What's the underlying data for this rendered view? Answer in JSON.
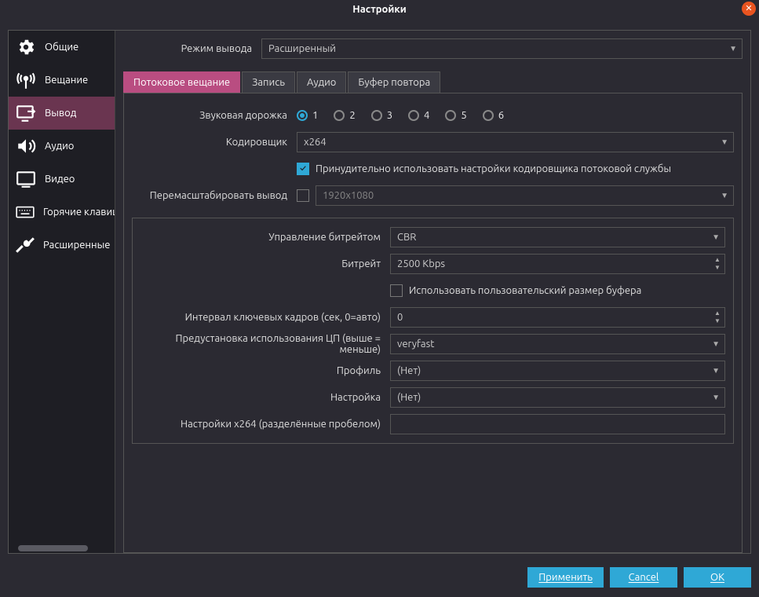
{
  "colors": {
    "accent": "#2fa8d6",
    "tab_active": "#b94d81",
    "sidebar_selected": "#6a3550"
  },
  "title": "Настройки",
  "sidebar": {
    "items": [
      {
        "id": "general",
        "label": "Общие"
      },
      {
        "id": "stream",
        "label": "Вещание"
      },
      {
        "id": "output",
        "label": "Вывод"
      },
      {
        "id": "audio",
        "label": "Аудио"
      },
      {
        "id": "video",
        "label": "Видео"
      },
      {
        "id": "hotkeys",
        "label": "Горячие клавиши"
      },
      {
        "id": "advanced",
        "label": "Расширенные"
      }
    ],
    "selected": "output"
  },
  "output_mode": {
    "label": "Режим вывода",
    "value": "Расширенный"
  },
  "tabs": [
    {
      "id": "streaming",
      "label": "Потоковое вещание"
    },
    {
      "id": "recording",
      "label": "Запись"
    },
    {
      "id": "audio",
      "label": "Аудио"
    },
    {
      "id": "replay",
      "label": "Буфер повтора"
    }
  ],
  "active_tab": "streaming",
  "streaming": {
    "audio_track_label": "Звуковая дорожка",
    "audio_tracks": [
      "1",
      "2",
      "3",
      "4",
      "5",
      "6"
    ],
    "audio_track_selected": "1",
    "encoder_label": "Кодировщик",
    "encoder_value": "x264",
    "enforce_label": "Принудительно использовать настройки кодировщика потоковой службы",
    "enforce_checked": true,
    "rescale_label": "Перемасштабировать вывод",
    "rescale_checked": false,
    "rescale_value": "1920x1080",
    "rate_control_label": "Управление битрейтом",
    "rate_control_value": "CBR",
    "bitrate_label": "Битрейт",
    "bitrate_value": "2500 Kbps",
    "custom_buf_label": "Использовать пользовательский размер буфера",
    "custom_buf_checked": false,
    "keyint_label": "Интервал ключевых кадров (сек, 0=авто)",
    "keyint_value": "0",
    "cpu_preset_label": "Предустановка использования ЦП (выше = меньше)",
    "cpu_preset_value": "veryfast",
    "profile_label": "Профиль",
    "profile_value": "(Нет)",
    "tune_label": "Настройка",
    "tune_value": "(Нет)",
    "x264opts_label": "Настройки x264 (разделённые пробелом)",
    "x264opts_value": ""
  },
  "footer": {
    "apply": "Применить",
    "cancel": "Cancel",
    "ok": "OK"
  }
}
